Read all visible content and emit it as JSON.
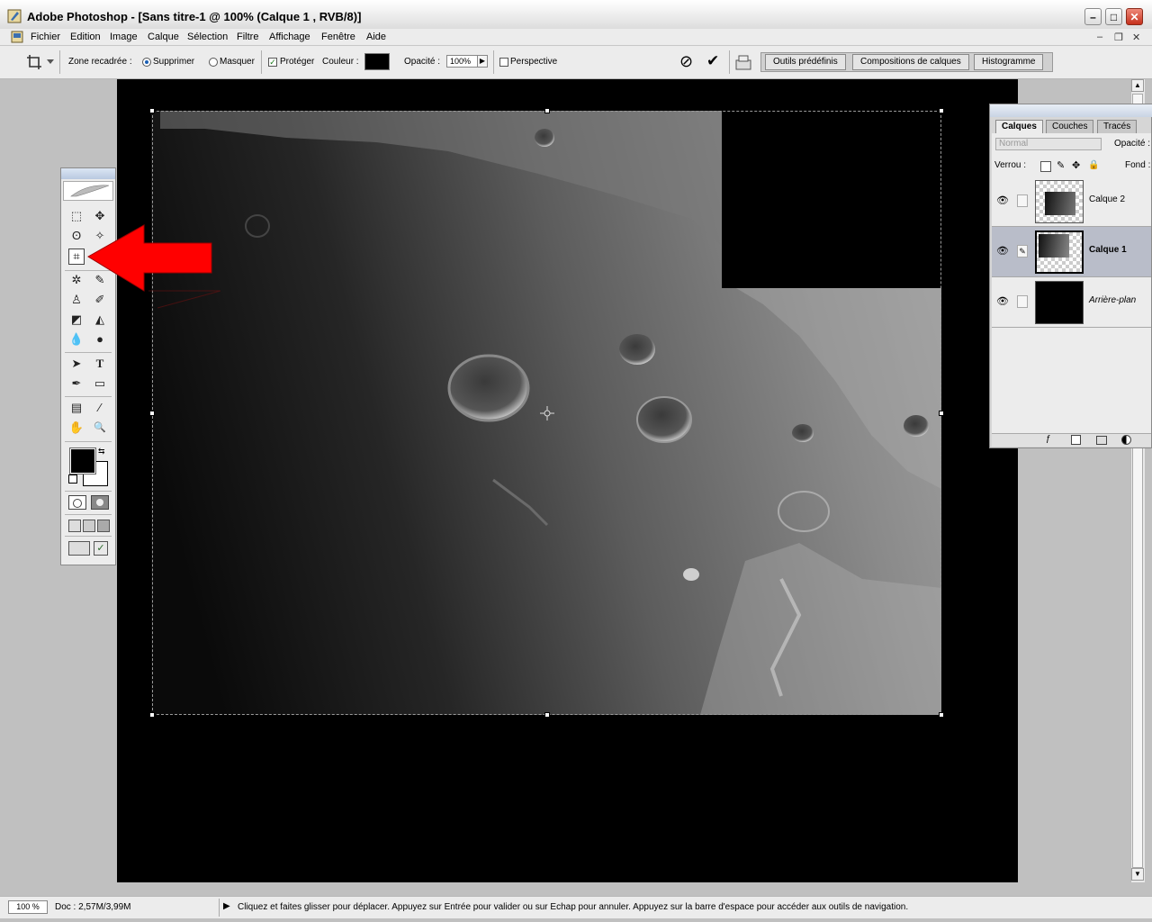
{
  "window": {
    "title": "Adobe Photoshop - [Sans titre-1 @ 100% (Calque 1 , RVB/8)]",
    "minimize": "–",
    "maximize": "□",
    "close": "✕"
  },
  "menu": {
    "items": [
      "Fichier",
      "Edition",
      "Image",
      "Calque",
      "Sélection",
      "Filtre",
      "Affichage",
      "Fenêtre",
      "Aide"
    ],
    "mdi_min": "–",
    "mdi_restore": "❐",
    "mdi_close": "✕"
  },
  "options": {
    "zone_label": "Zone recadrée :",
    "supprimer": "Supprimer",
    "masquer": "Masquer",
    "proteger": "Protéger",
    "couleur_label": "Couleur :",
    "opacite_label": "Opacité :",
    "opacite_value": "100%",
    "perspective": "Perspective",
    "cancel_glyph": "⊘",
    "commit_glyph": "✔",
    "well_tabs": [
      "Outils prédéfinis",
      "Compositions de calques",
      "Histogramme"
    ],
    "crop_color": "#000000"
  },
  "tools": {
    "glyphs": {
      "marquee": "⬚",
      "move": "✥",
      "lasso": "ʘ",
      "wand": "✧",
      "crop": "⌗",
      "slice": "↘",
      "heal": "✲",
      "brush": "✎",
      "stamp": "♙",
      "history": "✐",
      "eraser": "◩",
      "bucket": "◭",
      "blur": "💧",
      "dodge": "●",
      "path": "➤",
      "type": "T",
      "pen": "✒",
      "shape": "▭",
      "notes": "▤",
      "eyedropper": "⁄",
      "hand": "✋",
      "zoom": "🔍"
    }
  },
  "layers": {
    "tabs": [
      "Calques",
      "Couches",
      "Tracés"
    ],
    "blend_mode": "Normal",
    "opacity_label": "Opacité :",
    "lock_label": "Verrou :",
    "fill_label": "Fond :",
    "rows": [
      {
        "name": "Calque 2",
        "eye": "👁"
      },
      {
        "name": "Calque 1",
        "eye": "👁"
      },
      {
        "name": "Arrière-plan",
        "eye": "👁"
      }
    ]
  },
  "status": {
    "zoom": "100 %",
    "doc": "Doc : 2,57M/3,99M",
    "arrow": "▶",
    "hint": "Cliquez et faites glisser pour déplacer. Appuyez sur Entrée pour valider ou sur Echap pour annuler. Appuyez sur la barre d'espace pour accéder aux outils de navigation."
  }
}
